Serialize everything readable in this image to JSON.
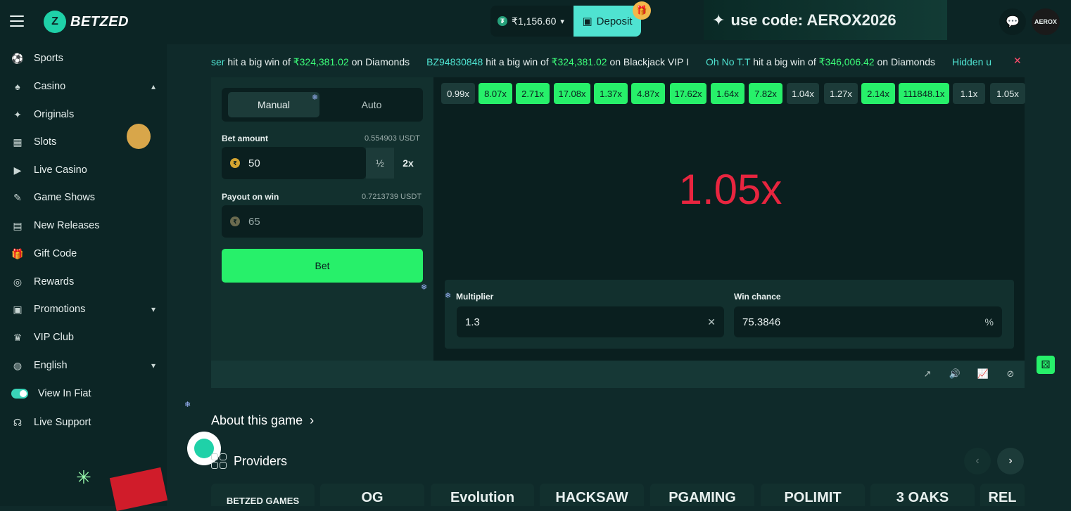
{
  "brand": {
    "name": "BETZED"
  },
  "header": {
    "balance": "₹1,156.60",
    "deposit_label": "Deposit",
    "promo_text": "use code: AEROX2026",
    "avatar_text": "AEROX"
  },
  "sidebar": {
    "items": [
      {
        "label": "Sports",
        "icon": "sports-icon"
      },
      {
        "label": "Casino",
        "icon": "casino-icon"
      },
      {
        "label": "Originals",
        "icon": "originals-icon"
      },
      {
        "label": "Slots",
        "icon": "slots-icon"
      },
      {
        "label": "Live Casino",
        "icon": "live-casino-icon"
      },
      {
        "label": "Game Shows",
        "icon": "game-shows-icon"
      },
      {
        "label": "New Releases",
        "icon": "new-releases-icon"
      },
      {
        "label": "Gift Code",
        "icon": "gift-icon"
      },
      {
        "label": "Rewards",
        "icon": "rewards-icon"
      },
      {
        "label": "Promotions",
        "icon": "promotions-icon"
      },
      {
        "label": "VIP Club",
        "icon": "crown-icon"
      },
      {
        "label": "English",
        "icon": "globe-icon"
      },
      {
        "label": "View In Fiat",
        "icon": "toggle"
      },
      {
        "label": "Live Support",
        "icon": "headset-icon"
      }
    ]
  },
  "ticker": [
    {
      "user": "ser",
      "text": "hit a big win of",
      "amount": "₹324,381.02",
      "game": "on Diamonds"
    },
    {
      "user": "BZ94830848",
      "text": "hit a big win of",
      "amount": "₹324,381.02",
      "game": "on Blackjack VIP I"
    },
    {
      "user": "Oh No T.T",
      "text": "hit a big win of",
      "amount": "₹346,006.42",
      "game": "on Diamonds"
    },
    {
      "user": "Hidden u",
      "text": "",
      "amount": "",
      "game": ""
    }
  ],
  "bet_panel": {
    "tab_manual": "Manual",
    "tab_auto": "Auto",
    "bet_amount_label": "Bet amount",
    "bet_amount_usdt": "0.554903 USDT",
    "bet_amount_value": "50",
    "half_label": "½",
    "double_label": "2x",
    "payout_label": "Payout on win",
    "payout_usdt": "0.7213739 USDT",
    "payout_value": "65",
    "bet_button": "Bet"
  },
  "history": [
    "0.99x",
    "8.07x",
    "2.71x",
    "17.08x",
    "1.37x",
    "4.87x",
    "17.62x",
    "1.64x",
    "7.82x",
    "1.04x",
    "1.27x",
    "2.14x",
    "111848.1x",
    "1.1x",
    "1.05x"
  ],
  "history_win": [
    false,
    true,
    true,
    true,
    true,
    true,
    true,
    true,
    true,
    false,
    false,
    true,
    true,
    false,
    false
  ],
  "result": "1.05x",
  "controls": {
    "multiplier_label": "Multiplier",
    "multiplier_value": "1.3",
    "win_chance_label": "Win chance",
    "win_chance_value": "75.3846",
    "win_chance_suffix": "%"
  },
  "about_label": "About this game",
  "providers_label": "Providers",
  "provider_cards": [
    "BETZED GAMES",
    "OG",
    "Evolution",
    "HACKSAW",
    "PGAMING",
    "POLIMIT",
    "3 OAKS",
    "REL"
  ],
  "colors": {
    "win": "#27f06a",
    "lose": "#1c3b39",
    "result": "#e8253f",
    "accent": "#4fe3d1"
  }
}
